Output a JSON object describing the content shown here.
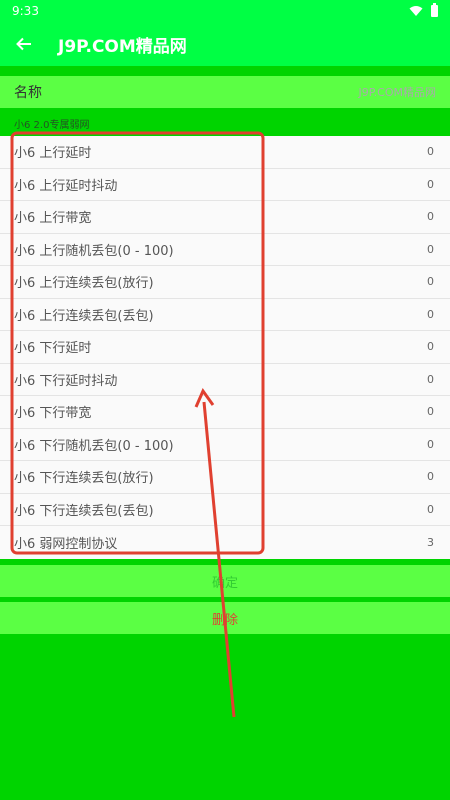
{
  "status_bar": {
    "time": "9:33"
  },
  "app_bar": {
    "title": "J9P.COM精品网"
  },
  "name_row": {
    "label": "名称",
    "value": "J9P.COM精品网"
  },
  "section": {
    "header": "小6 2.0专属弱网"
  },
  "list": {
    "items": [
      {
        "label": "小6  上行延时",
        "value": "0"
      },
      {
        "label": "小6  上行延时抖动",
        "value": "0"
      },
      {
        "label": "小6  上行带宽",
        "value": "0"
      },
      {
        "label": "小6  上行随机丢包(0 - 100)",
        "value": "0"
      },
      {
        "label": "小6  上行连续丢包(放行)",
        "value": "0"
      },
      {
        "label": "小6  上行连续丢包(丢包)",
        "value": "0"
      },
      {
        "label": "小6  下行延时",
        "value": "0"
      },
      {
        "label": "小6  下行延时抖动",
        "value": "0"
      },
      {
        "label": "小6  下行带宽",
        "value": "0"
      },
      {
        "label": "小6  下行随机丢包(0 - 100)",
        "value": "0"
      },
      {
        "label": "小6  下行连续丢包(放行)",
        "value": "0"
      },
      {
        "label": "小6  下行连续丢包(丢包)",
        "value": "0"
      },
      {
        "label": "小6  弱网控制协议",
        "value": "3"
      }
    ]
  },
  "buttons": {
    "confirm": "确定",
    "delete": "删除"
  },
  "colors": {
    "primary": "#00ff44",
    "background": "#00d400",
    "row_highlight": "#5bff44",
    "annotation": "#e04030"
  },
  "icons": {
    "back": "arrow-left-icon",
    "wifi": "wifi-icon",
    "battery": "battery-icon"
  }
}
